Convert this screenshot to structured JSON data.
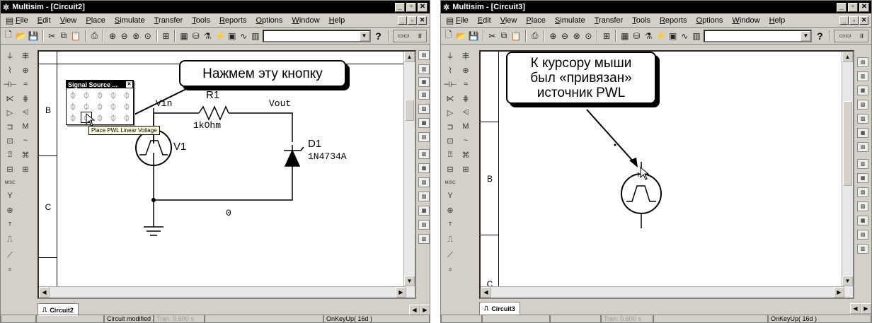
{
  "left": {
    "title": "Multisim - [Circuit2]",
    "menu": [
      "File",
      "Edit",
      "View",
      "Place",
      "Simulate",
      "Transfer",
      "Tools",
      "Reports",
      "Options",
      "Window",
      "Help"
    ],
    "zones": [
      "B",
      "C"
    ],
    "palette_title": "Signal Source ...",
    "tooltip": "Place PWL Linear Voltage",
    "callout": "Нажмем эту кнопку",
    "labels": {
      "vin": "Vin",
      "r1": "R1",
      "r1v": "1kOhm",
      "vout": "Vout",
      "v1": "V1",
      "d1": "D1",
      "d1v": "1N4734A",
      "gnd": "0",
      "plus": "+"
    },
    "tab": "Circuit2",
    "status": [
      "",
      "Circuit modified",
      "Tran: 0.600 s",
      "",
      "OnKeyUp( 16d )"
    ]
  },
  "right": {
    "title": "Multisim - [Circuit3]",
    "menu": [
      "File",
      "Edit",
      "View",
      "Place",
      "Simulate",
      "Transfer",
      "Tools",
      "Reports",
      "Options",
      "Window",
      "Help"
    ],
    "zones": [
      "B",
      "C"
    ],
    "callout": [
      "К курсору мыши",
      "был «привязан»",
      "источник PWL"
    ],
    "plus": "+",
    "tab": "Circuit3",
    "status": [
      "",
      "",
      "Tran: 0.600 s",
      "",
      "OnKeyUp( 16d )"
    ]
  },
  "icons": {
    "app": "multisim-logo-icon",
    "min": "minimize-icon",
    "max": "maximize-icon",
    "close": "close-icon",
    "help": "?",
    "palette_close": "close-icon"
  }
}
